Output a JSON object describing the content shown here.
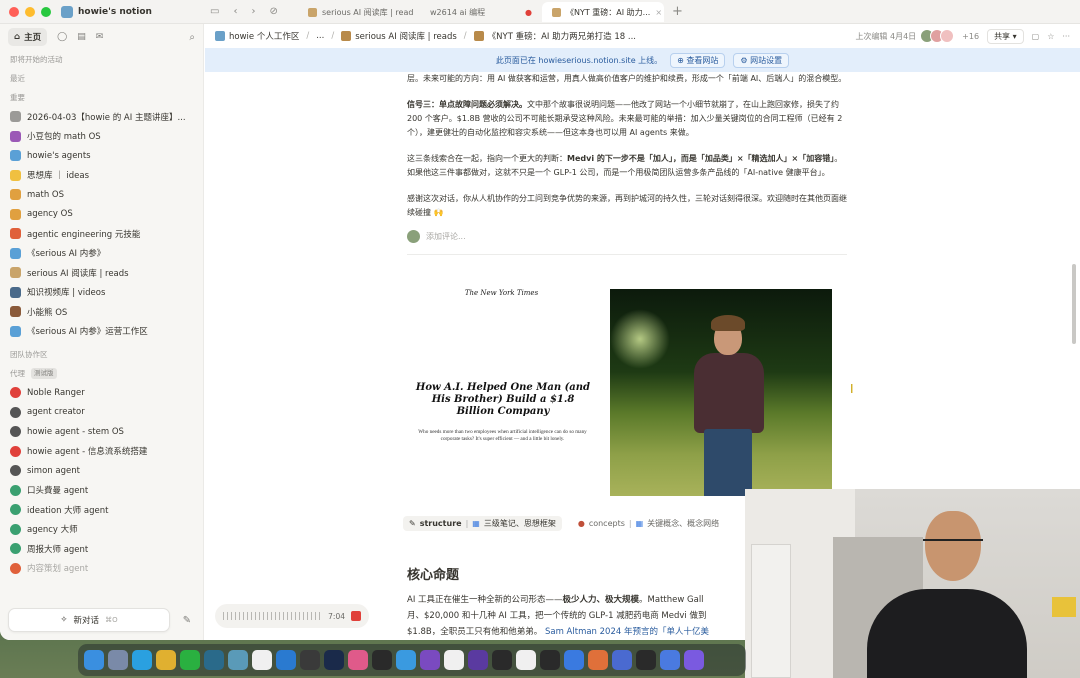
{
  "window": {
    "workspace_name": "howie's notion"
  },
  "tabs": [
    {
      "label": "serious AI 阅读库 | read"
    },
    {
      "label": "w2614 ai 编程"
    },
    {
      "label": "《NYT 重磅：AI 助力..."
    }
  ],
  "sidebar": {
    "home_label": "主页",
    "sections": {
      "upcoming": "即将开始的活动",
      "recent": "最近",
      "favorites": "重要",
      "team": "团队协作区",
      "agents": "代理",
      "agents_badge": "测试版"
    },
    "favorites": [
      {
        "label": "2026-04-03【howie 的 AI 主题讲座】...",
        "icon": "page-icon",
        "color": "#9b9a97"
      },
      {
        "label": "小豆包的 math OS",
        "icon": "heart-icon",
        "color": "#9b59b6"
      },
      {
        "label": "howie's agents",
        "icon": "robot-icon",
        "color": "#5aa0d6"
      },
      {
        "label": "思想库 ｜ ideas",
        "icon": "bulb-icon",
        "color": "#f0c040"
      },
      {
        "label": "math OS",
        "icon": "ruler-icon",
        "color": "#e0a040"
      },
      {
        "label": "agency OS",
        "icon": "muscle-icon",
        "color": "#e0a040"
      },
      {
        "label": "agentic engineering 元技能",
        "icon": "crab-icon",
        "color": "#e0603a"
      },
      {
        "label": "《serious AI 内参》",
        "icon": "robot-icon",
        "color": "#5aa0d6"
      },
      {
        "label": "serious AI 阅读库 | reads",
        "icon": "school-icon",
        "color": "#c9a46a"
      },
      {
        "label": "知识视频库 | videos",
        "icon": "monitor-icon",
        "color": "#4a6a8a"
      },
      {
        "label": "小能熊 OS",
        "icon": "bear-icon",
        "color": "#8a5a3a"
      },
      {
        "label": "《serious AI 内参》运营工作区",
        "icon": "robot-icon",
        "color": "#5aa0d6"
      }
    ],
    "agents": [
      {
        "label": "Noble Ranger",
        "icon": "target-icon",
        "color": "#e0403a"
      },
      {
        "label": "agent creator",
        "icon": "agent-icon",
        "color": "#555"
      },
      {
        "label": "howie agent - stem OS",
        "icon": "agent-icon",
        "color": "#555"
      },
      {
        "label": "howie agent - 信息流系统搭建",
        "icon": "alarm-icon",
        "color": "#e0403a"
      },
      {
        "label": "simon agent",
        "icon": "agent-icon",
        "color": "#555"
      },
      {
        "label": "口头費曼 agent",
        "icon": "agent-icon",
        "color": "#3aa070"
      },
      {
        "label": "ideation 大师 agent",
        "icon": "agent-icon",
        "color": "#3aa070"
      },
      {
        "label": "agency 大师",
        "icon": "agent-icon",
        "color": "#3aa070"
      },
      {
        "label": "周报大师 agent",
        "icon": "agent-icon",
        "color": "#3aa070"
      },
      {
        "label": "内容策划 agent",
        "icon": "agent-icon",
        "color": "#e0603a",
        "dim": true
      }
    ],
    "new_chat_label": "新对话",
    "new_chat_shortcut": "⌘O"
  },
  "topbar": {
    "breadcrumbs": [
      "howie 个人工作区",
      "...",
      "serious AI 阅读库 | reads",
      "《NYT 重磅：AI 助力两兄弟打造 18 ..."
    ],
    "last_edited": "上次编辑 4月4日",
    "collaborator_count": "+16",
    "share_label": "共享"
  },
  "banner": {
    "text": "此页面已在 howieserious.notion.site 上线。",
    "view_site": "查看网站",
    "site_settings": "网站设置"
  },
  "content": {
    "para0": "层。未来可能的方向：用 AI 做获客和运营，用真人做高价值客户的维护和续费，形成一个「前端 AI、后端人」的混合模型。",
    "signal3_label": "信号三：单点故障问题必须解决。",
    "signal3_text": "文中那个故事很说明问题——他改了网站一个小细节就崩了，在山上跑回家修，损失了约 200 个客户。$1.8B 营收的公司不可能长期承受这种风险。未来最可能的举措：加入少量关键岗位的合同工程师（已经有 2 个），建更健壮的自动化监控和容灾系统——但这本身也可以用 AI agents 来做。",
    "summary_a": "这三条线索合在一起，指向一个更大的判断：",
    "summary_b": "Medvi 的下一步不是「加人」，而是「加品类」×「精选加人」×「加容错」",
    "summary_c": "。如果他这三件事都做对，这就不只是一个 GLP-1 公司，而是一个用极简团队运营多条产品线的「AI-native 健康平台」。",
    "thanks": "感谢这次对话，你从人机协作的分工问到竞争优势的来源，再到护城河的持久性，三轮对话刻得很深。欢迎随时在其他页面继续碰撞 🙌",
    "comment_placeholder": "添加评论..."
  },
  "nyt": {
    "masthead": "The New York Times",
    "headline": "How A.I. Helped One Man (and His Brother) Build a $1.8 Billion Company",
    "subhead": "Who needs more than two employees when artificial intelligence can do so many corporate tasks? It's super efficient — and a little bit lonely."
  },
  "tags": {
    "structure_key": "structure",
    "structure_val": "三级笔记、思想框架",
    "concepts_key": "concepts",
    "concepts_val": "关键概念、概念网络"
  },
  "section": {
    "heading": "核心命题",
    "line1_a": "AI 工具正在催生一种全新的公司形态——",
    "line1_b": "极少人力、极大规模",
    "line1_c": "。Matthew Gall",
    "line2": "月、$20,000 和十几种 AI 工具，把一个传统的 GLP-1 减肥药电商 Medvi 做到",
    "line3_a": "$1.8B，全职员工只有他和他弟弟。",
    "line3_b": "Sam Altman 2024 年预言的「单人十亿美"
  },
  "recording": {
    "time": "7:04"
  },
  "dock": {
    "apps": [
      {
        "name": "finder-icon",
        "color": "#3a8fe0"
      },
      {
        "name": "launchpad-icon",
        "color": "#7a8aa8"
      },
      {
        "name": "telegram-icon",
        "color": "#2aa0e0"
      },
      {
        "name": "chrome-icon",
        "color": "#e0b030"
      },
      {
        "name": "wechat-icon",
        "color": "#2ab040"
      },
      {
        "name": "arc-icon",
        "color": "#2a6a8a"
      },
      {
        "name": "app-icon",
        "color": "#5a9ab8"
      },
      {
        "name": "notes-icon",
        "color": "#f0f0f0"
      },
      {
        "name": "vscode-icon",
        "color": "#2a7ad0"
      },
      {
        "name": "cube-icon",
        "color": "#3a3a3a"
      },
      {
        "name": "r-icon",
        "color": "#1a2a4a"
      },
      {
        "name": "magnet-icon",
        "color": "#e05a8a"
      },
      {
        "name": "figma-icon",
        "color": "#2a2a2a"
      },
      {
        "name": "safari-icon",
        "color": "#3a9ae0"
      },
      {
        "name": "obsidian-icon",
        "color": "#7a4ac0"
      },
      {
        "name": "notion-icon",
        "color": "#f0f0f0"
      },
      {
        "name": "play-icon",
        "color": "#5a3aa0"
      },
      {
        "name": "chatgpt-icon",
        "color": "#2a2a2a"
      },
      {
        "name": "panda-icon",
        "color": "#f0f0f0"
      },
      {
        "name": "cursor-app-icon",
        "color": "#2a2a2a"
      },
      {
        "name": "star-icon",
        "color": "#3a7ae0"
      },
      {
        "name": "claude-icon",
        "color": "#e0703a"
      },
      {
        "name": "screen-icon",
        "color": "#4a6ad0"
      },
      {
        "name": "video-icon",
        "color": "#2a2a2a"
      },
      {
        "name": "zoom-icon",
        "color": "#4a7ae0"
      },
      {
        "name": "stripe-icon",
        "color": "#7a5ae0"
      }
    ]
  }
}
